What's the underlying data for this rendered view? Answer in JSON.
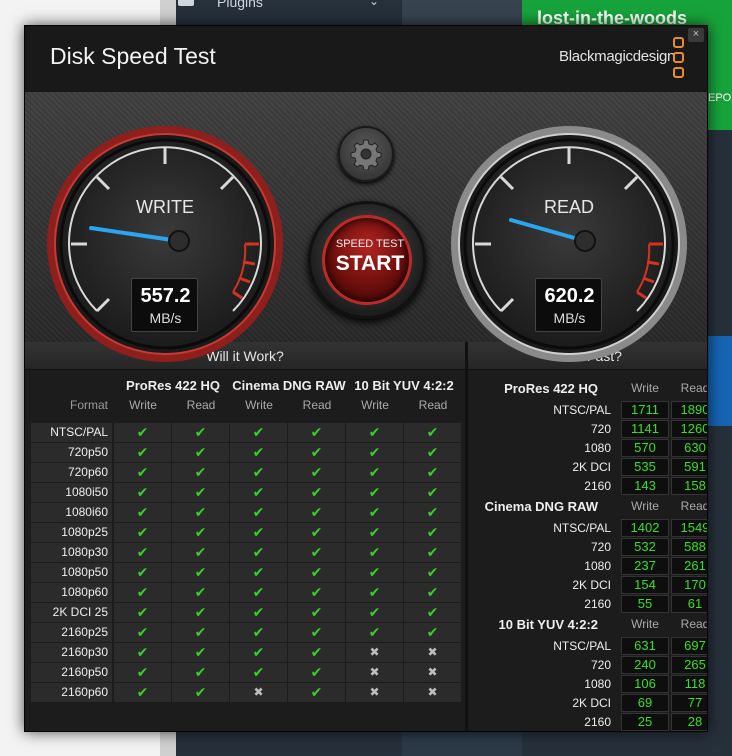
{
  "background": {
    "plugins_label": "Plugins",
    "green_title": "lost-in-the-woods",
    "green_sub": "EPO"
  },
  "app": {
    "title": "Disk Speed Test",
    "brand": "Blackmagicdesign",
    "close_glyph": "×",
    "accent_color": "#e98c2a"
  },
  "gauges": {
    "write": {
      "label": "WRITE",
      "value": "557.2",
      "unit": "MB/s"
    },
    "read": {
      "label": "READ",
      "value": "620.2",
      "unit": "MB/s"
    }
  },
  "start_button": {
    "top_label": "SPEED TEST",
    "main_label": "START"
  },
  "settings_icon": "gear-icon",
  "will_it_work": {
    "title": "Will it Work?",
    "format_label": "Format",
    "codecs": [
      "ProRes 422 HQ",
      "Cinema DNG RAW",
      "10 Bit YUV 4:2:2"
    ],
    "sub_labels": [
      "Write",
      "Read"
    ],
    "rows": [
      {
        "format": "NTSC/PAL",
        "results": [
          true,
          true,
          true,
          true,
          true,
          true
        ]
      },
      {
        "format": "720p50",
        "results": [
          true,
          true,
          true,
          true,
          true,
          true
        ]
      },
      {
        "format": "720p60",
        "results": [
          true,
          true,
          true,
          true,
          true,
          true
        ]
      },
      {
        "format": "1080i50",
        "results": [
          true,
          true,
          true,
          true,
          true,
          true
        ]
      },
      {
        "format": "1080i60",
        "results": [
          true,
          true,
          true,
          true,
          true,
          true
        ]
      },
      {
        "format": "1080p25",
        "results": [
          true,
          true,
          true,
          true,
          true,
          true
        ]
      },
      {
        "format": "1080p30",
        "results": [
          true,
          true,
          true,
          true,
          true,
          true
        ]
      },
      {
        "format": "1080p50",
        "results": [
          true,
          true,
          true,
          true,
          true,
          true
        ]
      },
      {
        "format": "1080p60",
        "results": [
          true,
          true,
          true,
          true,
          true,
          true
        ]
      },
      {
        "format": "2K DCI 25",
        "results": [
          true,
          true,
          true,
          true,
          true,
          true
        ]
      },
      {
        "format": "2160p25",
        "results": [
          true,
          true,
          true,
          true,
          true,
          true
        ]
      },
      {
        "format": "2160p30",
        "results": [
          true,
          true,
          true,
          true,
          false,
          false
        ]
      },
      {
        "format": "2160p50",
        "results": [
          true,
          true,
          true,
          true,
          false,
          false
        ]
      },
      {
        "format": "2160p60",
        "results": [
          true,
          true,
          false,
          true,
          false,
          false
        ]
      }
    ]
  },
  "how_fast": {
    "title": "How Fast?",
    "sub_labels": [
      "Write",
      "Read"
    ],
    "groups": [
      {
        "codec": "ProRes 422 HQ",
        "rows": [
          {
            "format": "NTSC/PAL",
            "write": "1711",
            "read": "1890"
          },
          {
            "format": "720",
            "write": "1141",
            "read": "1260"
          },
          {
            "format": "1080",
            "write": "570",
            "read": "630"
          },
          {
            "format": "2K DCI",
            "write": "535",
            "read": "591"
          },
          {
            "format": "2160",
            "write": "143",
            "read": "158"
          }
        ]
      },
      {
        "codec": "Cinema DNG RAW",
        "rows": [
          {
            "format": "NTSC/PAL",
            "write": "1402",
            "read": "1549"
          },
          {
            "format": "720",
            "write": "532",
            "read": "588"
          },
          {
            "format": "1080",
            "write": "237",
            "read": "261"
          },
          {
            "format": "2K DCI",
            "write": "154",
            "read": "170"
          },
          {
            "format": "2160",
            "write": "55",
            "read": "61"
          }
        ]
      },
      {
        "codec": "10 Bit YUV 4:2:2",
        "rows": [
          {
            "format": "NTSC/PAL",
            "write": "631",
            "read": "697"
          },
          {
            "format": "720",
            "write": "240",
            "read": "265"
          },
          {
            "format": "1080",
            "write": "106",
            "read": "118"
          },
          {
            "format": "2K DCI",
            "write": "69",
            "read": "77"
          },
          {
            "format": "2160",
            "write": "25",
            "read": "28"
          }
        ]
      }
    ]
  }
}
